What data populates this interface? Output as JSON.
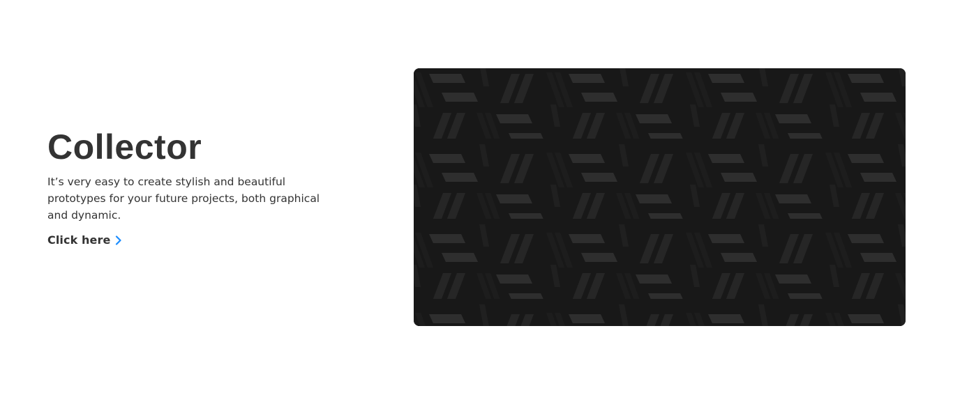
{
  "hero": {
    "title": "Collector",
    "description": "It’s very easy to create stylish and beautiful prototypes for your future projects, both graphical and dynamic.",
    "cta_label": "Click here",
    "cta_icon": "chevron-right-icon",
    "media_icon": "geometric-pattern"
  },
  "colors": {
    "accent": "#1a8cff",
    "text": "#333333",
    "media_background": "#181818",
    "pattern_light": "#2e2e2e",
    "pattern_mid": "#232323"
  }
}
